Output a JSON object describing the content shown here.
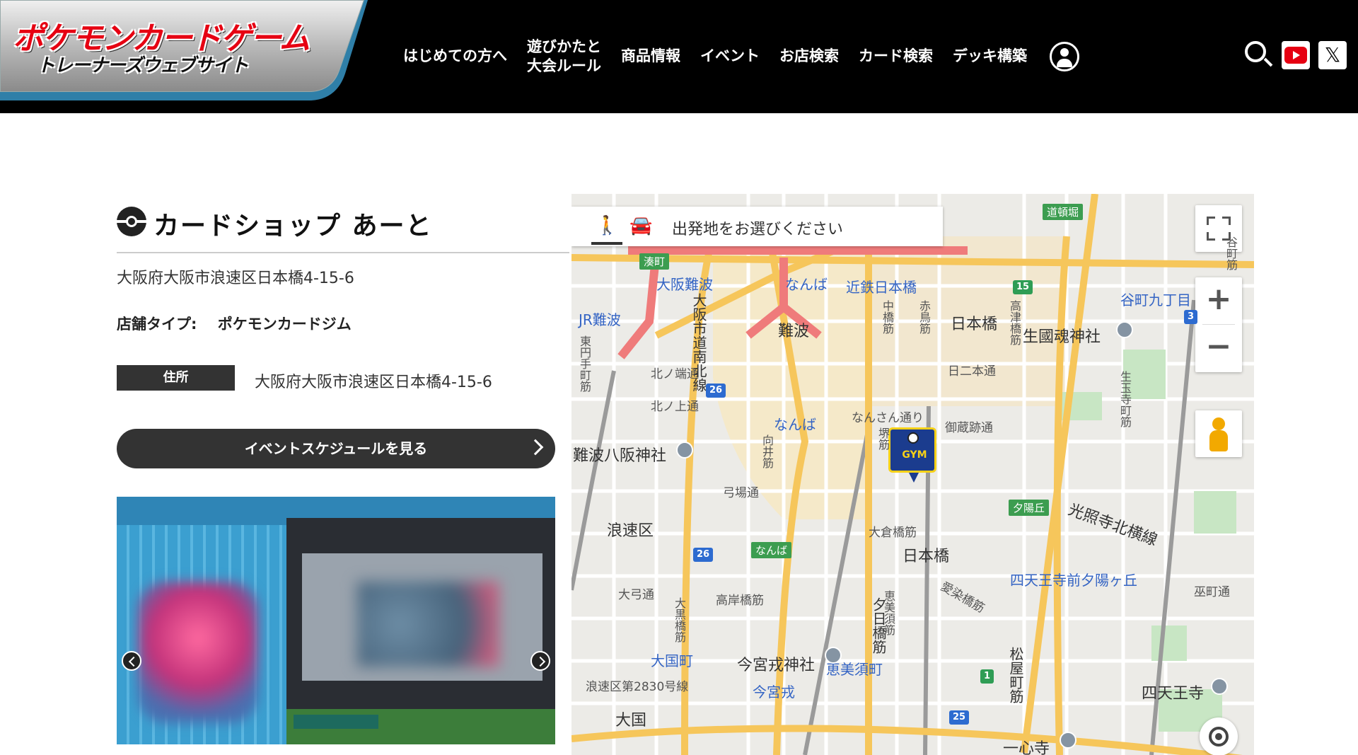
{
  "header": {
    "logo_line1": "ポケモンカードゲーム",
    "logo_line2": "トレーナーズウェブサイト",
    "nav": [
      {
        "label": "はじめての方へ"
      },
      {
        "label_line1": "遊びかたと",
        "label_line2": "大会ルール"
      },
      {
        "label": "商品情報"
      },
      {
        "label": "イベント"
      },
      {
        "label": "お店検索"
      },
      {
        "label": "カード検索"
      },
      {
        "label": "デッキ構築"
      }
    ],
    "icons": [
      "user-icon",
      "search-icon",
      "youtube-icon",
      "x-icon"
    ],
    "x_glyph": "𝕏"
  },
  "shop": {
    "name": "カードショップ あーと",
    "address": "大阪府大阪市浪速区日本橋4-15-6",
    "type_label": "店舗タイプ:",
    "type_value": "ポケモンカードジム",
    "address_badge": "住所",
    "address_value": "大阪府大阪市浪速区日本橋4-15-6",
    "event_button": "イベントスケジュールを見る"
  },
  "map": {
    "route_prompt": "出発地をお選びください",
    "gym_pin_text": "GYM",
    "labels": {
      "doutonbori": "道頓堀",
      "minatomachi": "湊町",
      "osaka_namba": "大阪難波",
      "namba_mido": "なんば",
      "kintetsu": "近鉄日本橋",
      "tanimachi": "谷町九丁目",
      "jr_namba": "JR難波",
      "namba": "難波",
      "nipponbashi_area": "日本橋",
      "ikukunitama": "生國魂神社",
      "nipponbashi_2": "日二本通",
      "kita_nishi": "北ノ端通",
      "kita_ue": "北ノ上通",
      "namba_station": "なんば",
      "nansan": "なんさん通り",
      "gozobashi": "御蔵跡通",
      "namba_yasaka": "難波八阪神社",
      "yumiba": "弓場通",
      "naniwa": "浪速区",
      "yuhigaoka": "夕陽丘",
      "koshoji": "光照寺北横線",
      "okuramachi": "大倉橋筋",
      "nipponbashi_3": "日本橋",
      "namba_tag": "なんば",
      "shitennoji_yuhi": "四天王寺前夕陽ヶ丘",
      "dairoku": "大弓通",
      "takahashi": "高岸橋筋",
      "aizome": "愛染橋筋",
      "minami_dori": "巫町通",
      "daikokucho": "大国町",
      "imamiya_ebisu": "今宮戎神社",
      "ebisucho": "恵美須町",
      "imamiya": "今宮戎",
      "naniwa_2830": "浪速区第2830号線",
      "shitennoji": "四天王寺",
      "daikoku": "大国",
      "isshinji": "一心寺",
      "osaka_douro": "大阪市道南北線",
      "higashi_enmachi": "東円手町筋",
      "nakanohashi": "中橋筋",
      "akagawa": "赤鳥筋",
      "takatsu": "高津橋筋",
      "shimo_teramachi": "生玉寺町筋",
      "matsuyamachi": "松屋町筋",
      "yuhi_bashi": "夕日橋筋",
      "ebisu_hanamichi": "恵美須筋",
      "aizomebashi_street": "大黒橋筋",
      "ikuno": "谷町筋",
      "sakaisuji": "堺筋",
      "minami": "向井筋",
      "r26a": "26",
      "r26b": "26",
      "r25": "25",
      "r15": "15",
      "r1": "1",
      "r3": "3"
    }
  }
}
